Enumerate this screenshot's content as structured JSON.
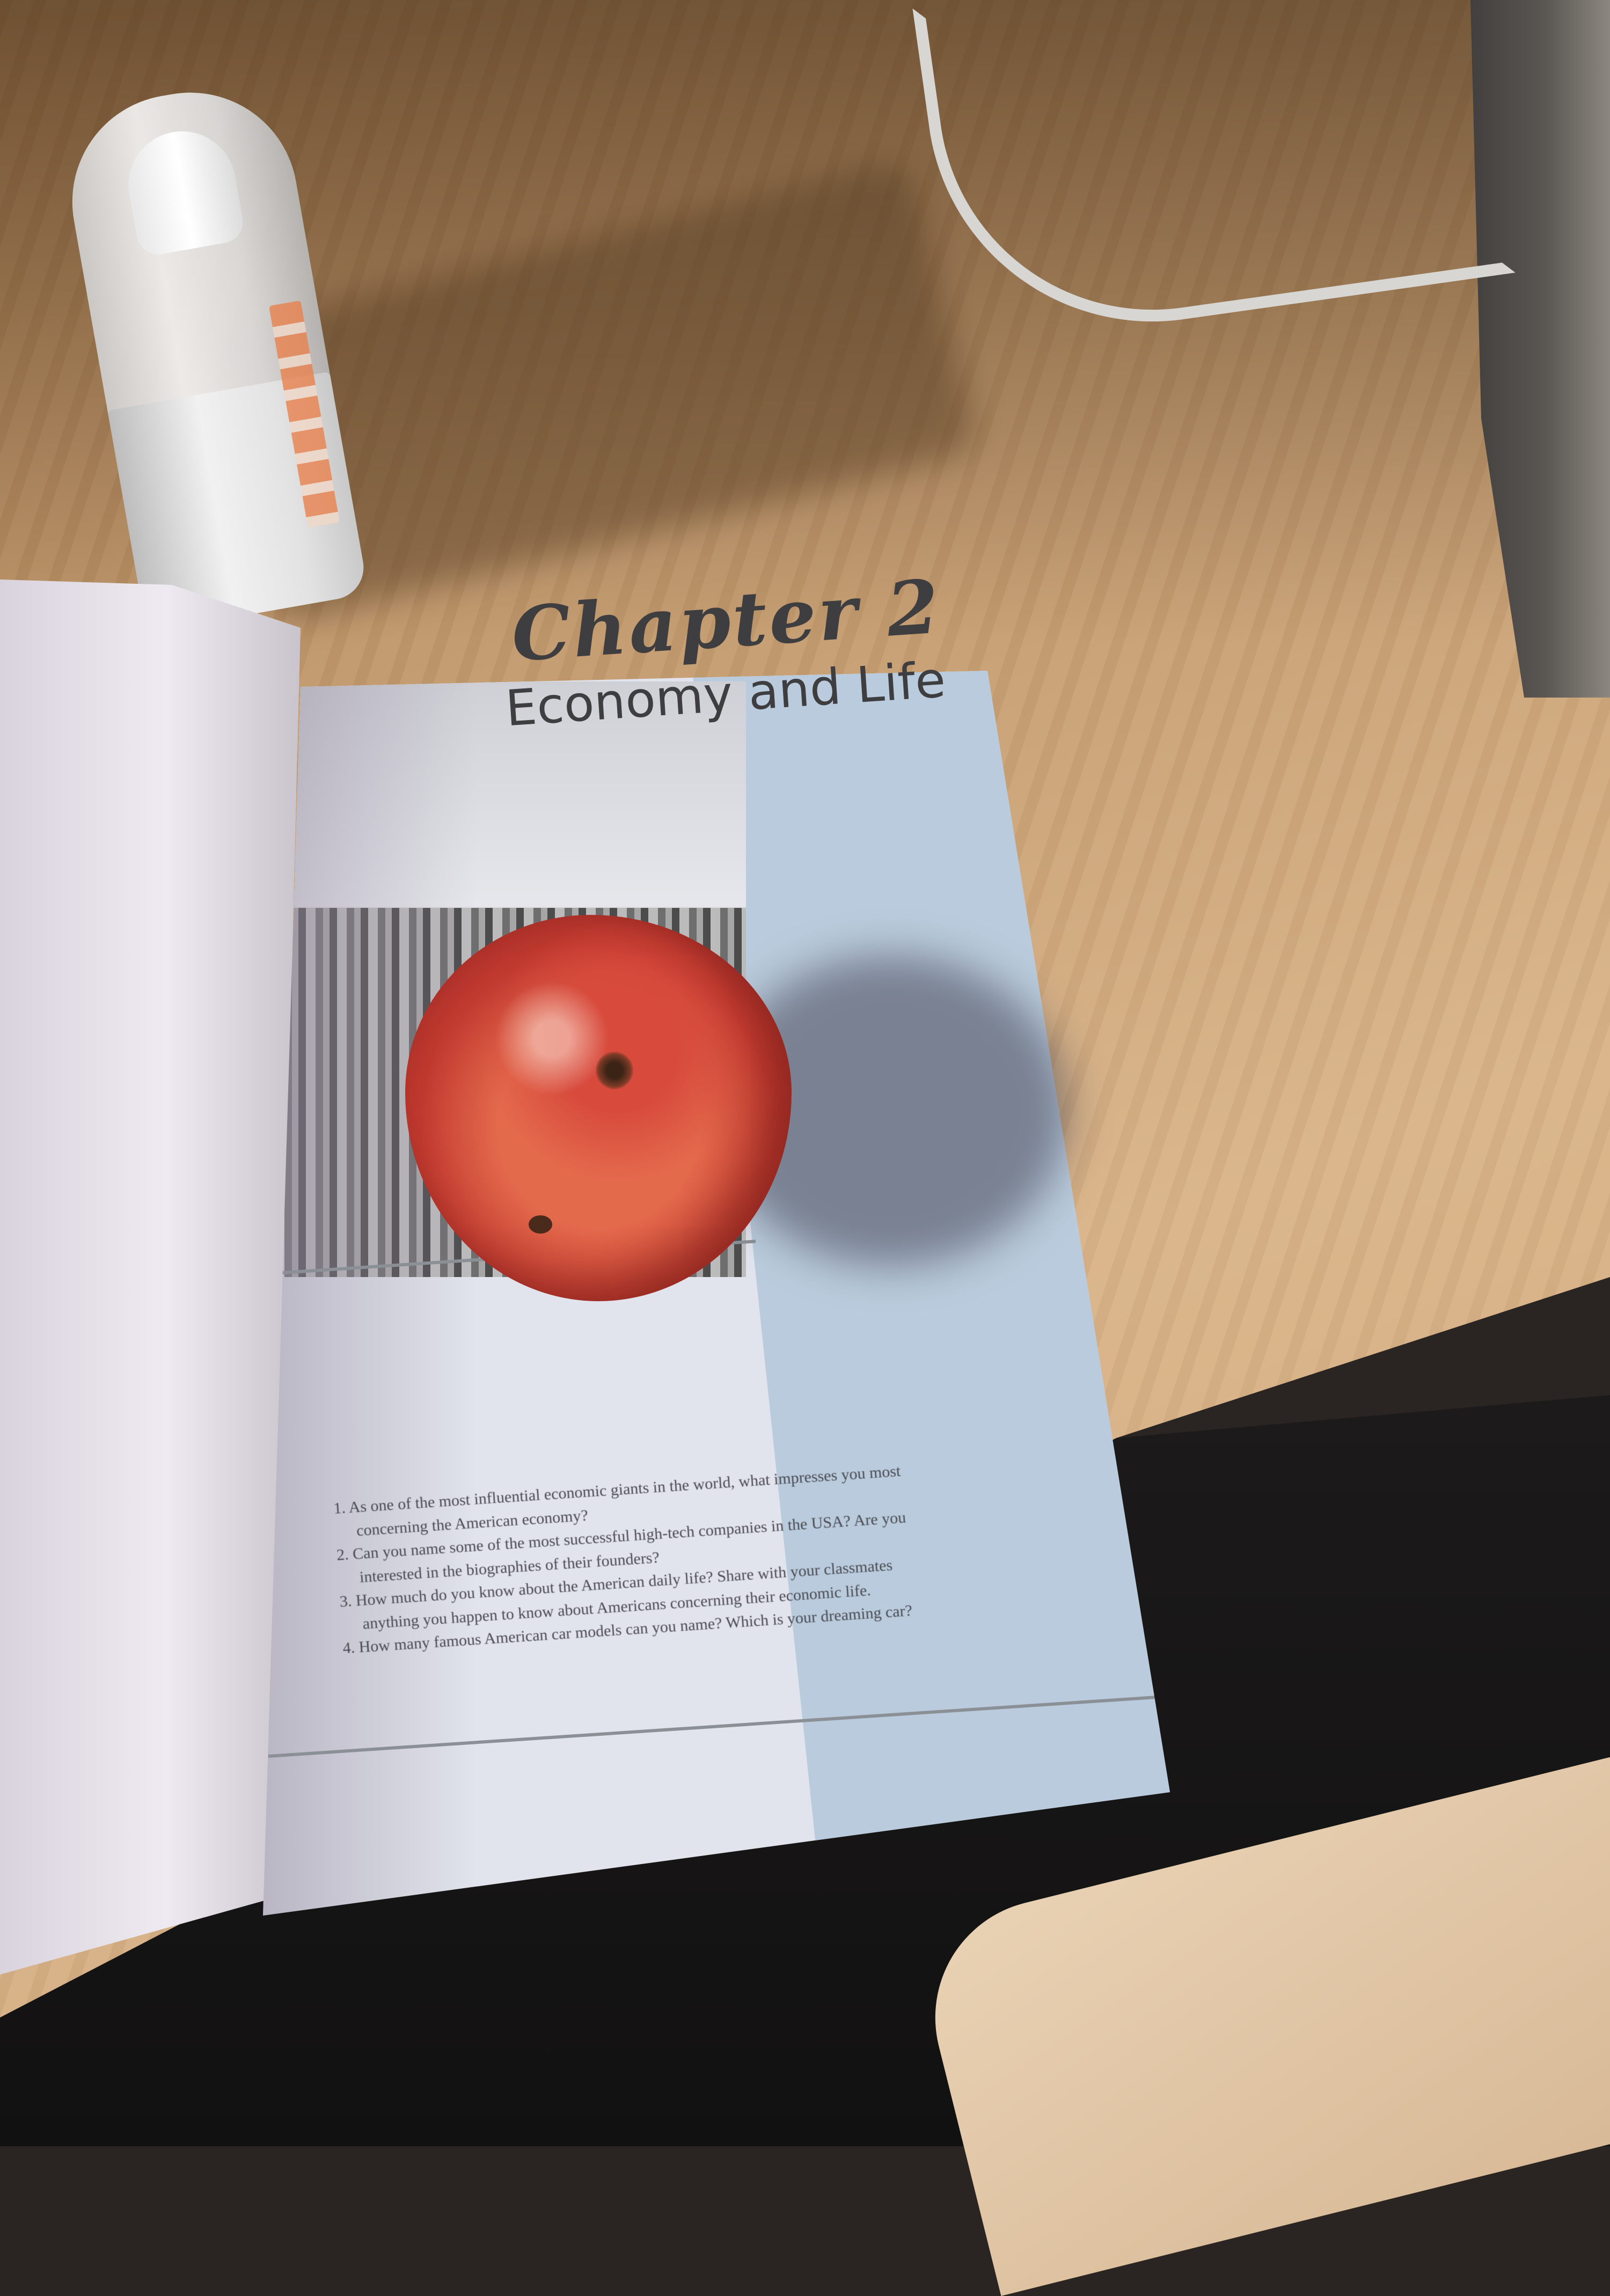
{
  "chapter": {
    "title": "Chapter 2",
    "subtitle": "Economy and Life"
  },
  "questions": [
    "1. As one of the most influential economic giants in the world, what impresses you most",
    "concerning the American economy?",
    "2. Can you name some of the most successful high-tech companies in the USA? Are you",
    "interested in the biographies of their founders?",
    "3. How much do you know about the American daily life? Share with your classmates",
    "anything you happen to know about Americans concerning their economic life.",
    "4. How many famous American car models can you name? Which is your dreaming car?"
  ]
}
